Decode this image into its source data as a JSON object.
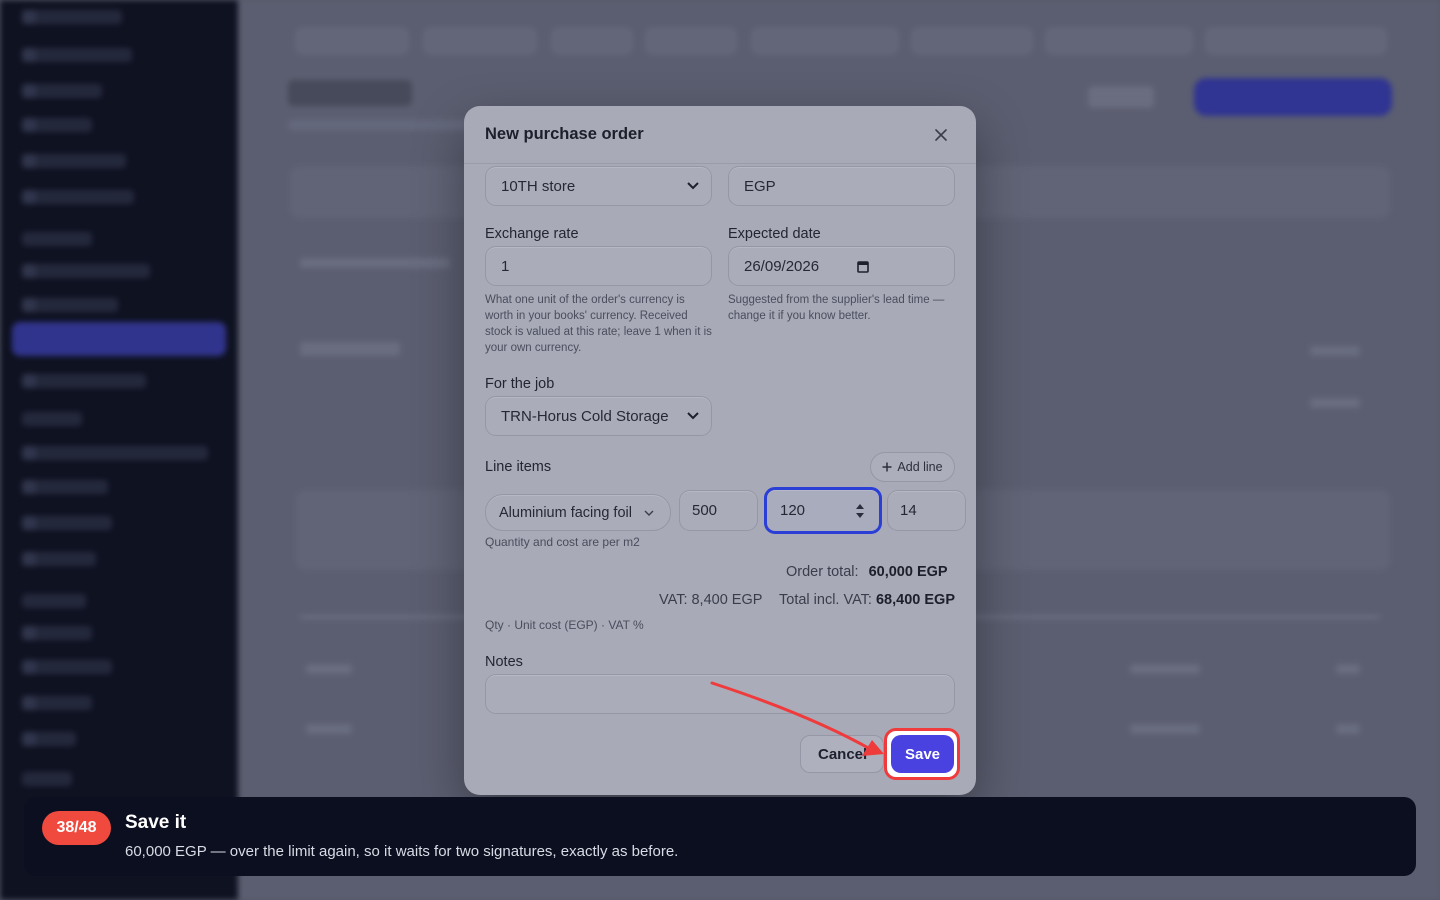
{
  "modal": {
    "title": "New purchase order",
    "store_select": "10TH store",
    "currency": "EGP",
    "exchange_rate_label": "Exchange rate",
    "exchange_rate_value": "1",
    "exchange_rate_help": "What one unit of the order's currency is worth in your books' currency. Received stock is valued at this rate; leave 1 when it is your own currency.",
    "expected_date_label": "Expected date",
    "expected_date_value": "26/09/2026",
    "expected_date_help": "Suggested from the supplier's lead time — change it if you know better.",
    "job_label": "For the job",
    "job_select": "TRN-Horus Cold Storage",
    "line_items_label": "Line items",
    "add_line_label": "Add line",
    "line_item": {
      "product": "Aluminium facing foil",
      "quantity": "500",
      "unit_cost": "120",
      "vat": "14"
    },
    "line_item_help": "Quantity and cost are per m2",
    "order_total_label": "Order total:",
    "order_total_value": "60,000 EGP",
    "vat_text": "VAT: 8,400 EGP",
    "total_incl_label": "Total incl. VAT:",
    "total_incl_value": "68,400 EGP",
    "columns_hint": "Qty · Unit cost (EGP) · VAT %",
    "notes_label": "Notes",
    "notes_value": "",
    "cancel_label": "Cancel",
    "save_label": "Save"
  },
  "tutorial": {
    "step": "38/48",
    "title": "Save it",
    "description": "60,000 EGP — over the limit again, so it waits for two signatures, exactly as before."
  },
  "colors": {
    "accent": "#4a42e0",
    "highlight": "#ef3b3b",
    "badge": "#f04a3e"
  }
}
